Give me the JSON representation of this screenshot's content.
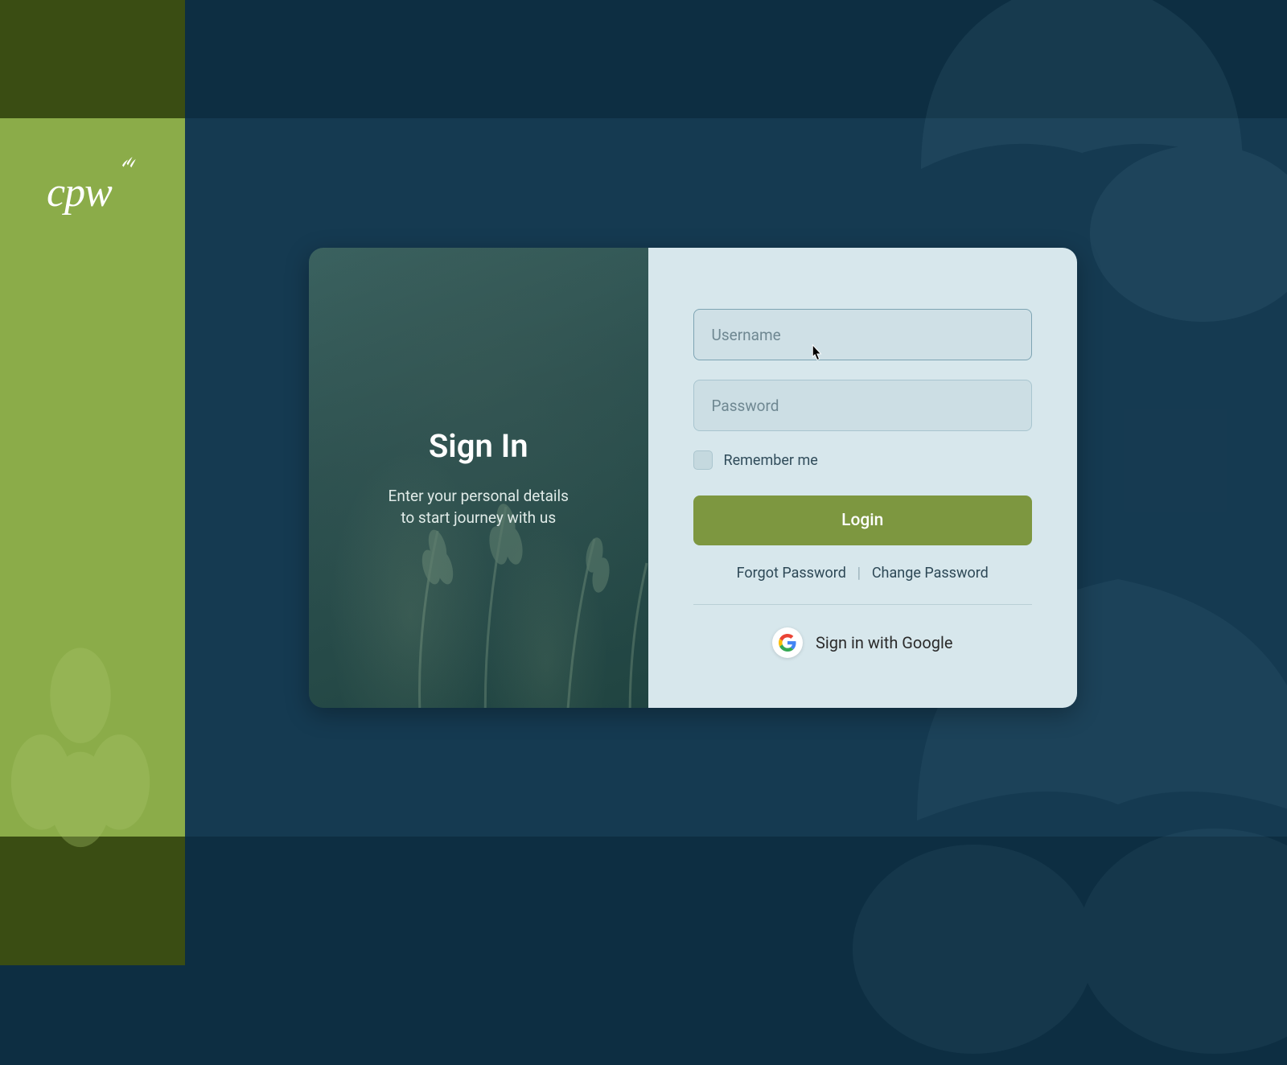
{
  "brand": {
    "name": "cpw"
  },
  "hero": {
    "title": "Sign In",
    "subtitle_line1": "Enter your personal details",
    "subtitle_line2": "to start journey with us"
  },
  "form": {
    "username": {
      "placeholder": "Username",
      "value": ""
    },
    "password": {
      "placeholder": "Password",
      "value": ""
    },
    "remember_label": "Remember me",
    "login_label": "Login",
    "forgot_label": "Forgot Password",
    "change_label": "Change Password",
    "google_label": "Sign in with Google"
  },
  "colors": {
    "accent_green": "#7d9740",
    "sidebar_green": "#8bac49",
    "dark_olive": "#3a4d13",
    "bg_navy": "#0d2e42",
    "card_right_bg": "#d7e7ec"
  }
}
